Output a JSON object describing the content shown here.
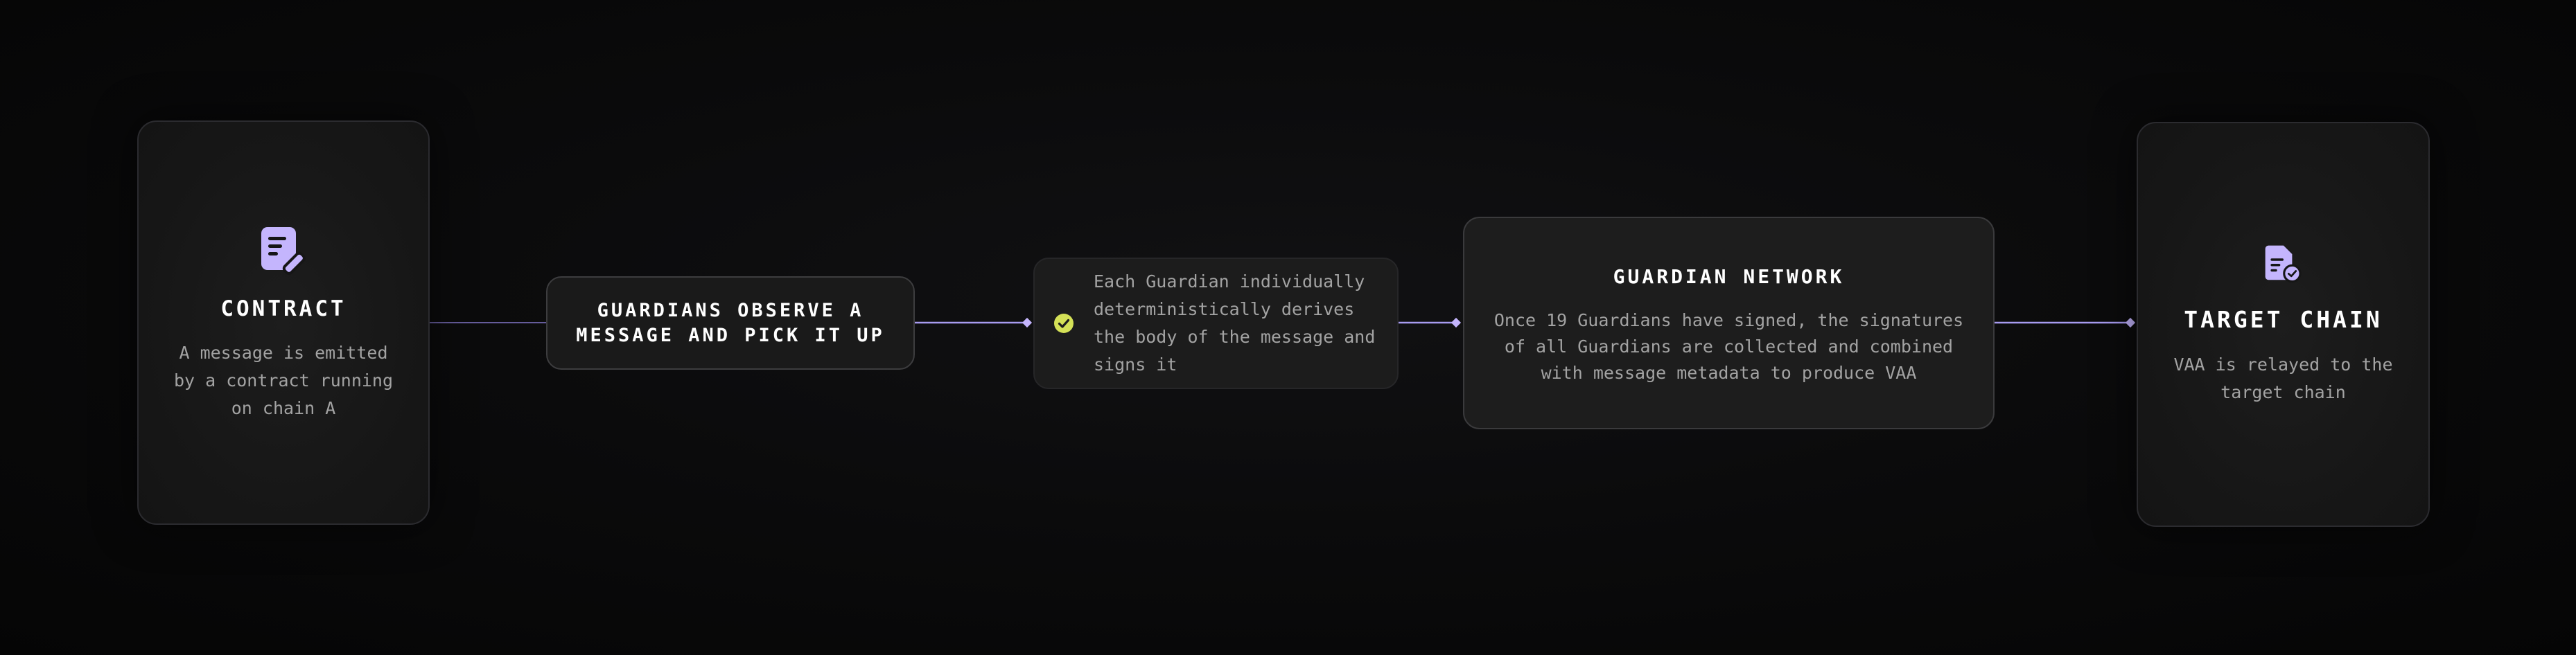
{
  "colors": {
    "accent": "#c4b5fd",
    "check": "#d4e157",
    "connector": "#8b7fd8",
    "text_primary": "#ffffff",
    "text_secondary": "#a3a3a3"
  },
  "nodes": {
    "contract": {
      "icon": "document-edit-icon",
      "title": "CONTRACT",
      "desc_lines": [
        "A message is emitted",
        "by a contract running",
        "on chain A"
      ]
    },
    "observe": {
      "title_lines": [
        "GUARDIANS OBSERVE A",
        "MESSAGE AND PICK IT UP"
      ]
    },
    "derive": {
      "icon": "check-circle-icon",
      "text_lines": [
        "Each Guardian individually",
        "deterministically derives",
        "the body of the message and",
        "signs it"
      ]
    },
    "network": {
      "title": "GUARDIAN NETWORK",
      "desc_lines": [
        "Once 19 Guardians have signed, the signatures",
        "of all Guardians are collected and combined",
        "with message metadata to produce VAA"
      ]
    },
    "target": {
      "icon": "document-check-icon",
      "title": "TARGET CHAIN",
      "desc_lines": [
        "VAA is relayed to the",
        "target chain"
      ]
    }
  },
  "connectors": [
    {
      "from": "contract",
      "to": "observe"
    },
    {
      "from": "observe",
      "to": "derive"
    },
    {
      "from": "derive",
      "to": "network"
    },
    {
      "from": "network",
      "to": "target"
    }
  ]
}
